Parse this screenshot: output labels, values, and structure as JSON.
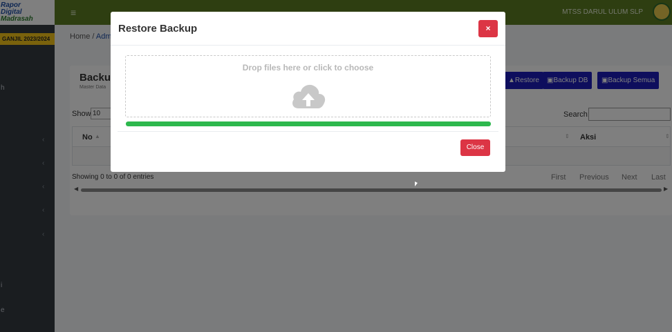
{
  "brand": {
    "line1": "Rapor",
    "line2": "Digital",
    "line3": "Madrasah"
  },
  "semester": "GANJIL 2023/2024",
  "sidebar": {
    "letters": [
      "h",
      "i",
      "e"
    ],
    "chevrons": [
      "‹",
      "‹",
      "‹",
      "‹",
      "‹"
    ]
  },
  "header": {
    "menu_icon": "≡",
    "school_name": "MTSS DARUL ULUM SLP"
  },
  "breadcrumb": {
    "home": "Home",
    "separator": "/",
    "current": "Adm"
  },
  "card": {
    "title": "Backup",
    "subtitle": "Master Data",
    "buttons": {
      "restore": "Restore",
      "backup_db": "Backup DB",
      "backup_all": "Backup Semua"
    }
  },
  "table": {
    "show_label": "Show",
    "page_size": "10",
    "search_label": "Search:",
    "columns": {
      "no": "No",
      "aksi": "Aksi"
    },
    "info": "Showing 0 to 0 of 0 entries",
    "pager": {
      "first": "First",
      "previous": "Previous",
      "next": "Next",
      "last": "Last"
    }
  },
  "modal": {
    "title": "Restore Backup",
    "close_x": "×",
    "dropzone_text": "Drop files here or click to choose",
    "dropzone_icon": "cloud-upload-icon",
    "progress_percent": 100,
    "close_label": "Close"
  },
  "colors": {
    "header": "#5c7d23",
    "sidebar": "#343a40",
    "danger": "#dc3545",
    "primary_button": "#1c1cba",
    "progress": "#2db84d",
    "semester_badge": "#f5c518"
  }
}
